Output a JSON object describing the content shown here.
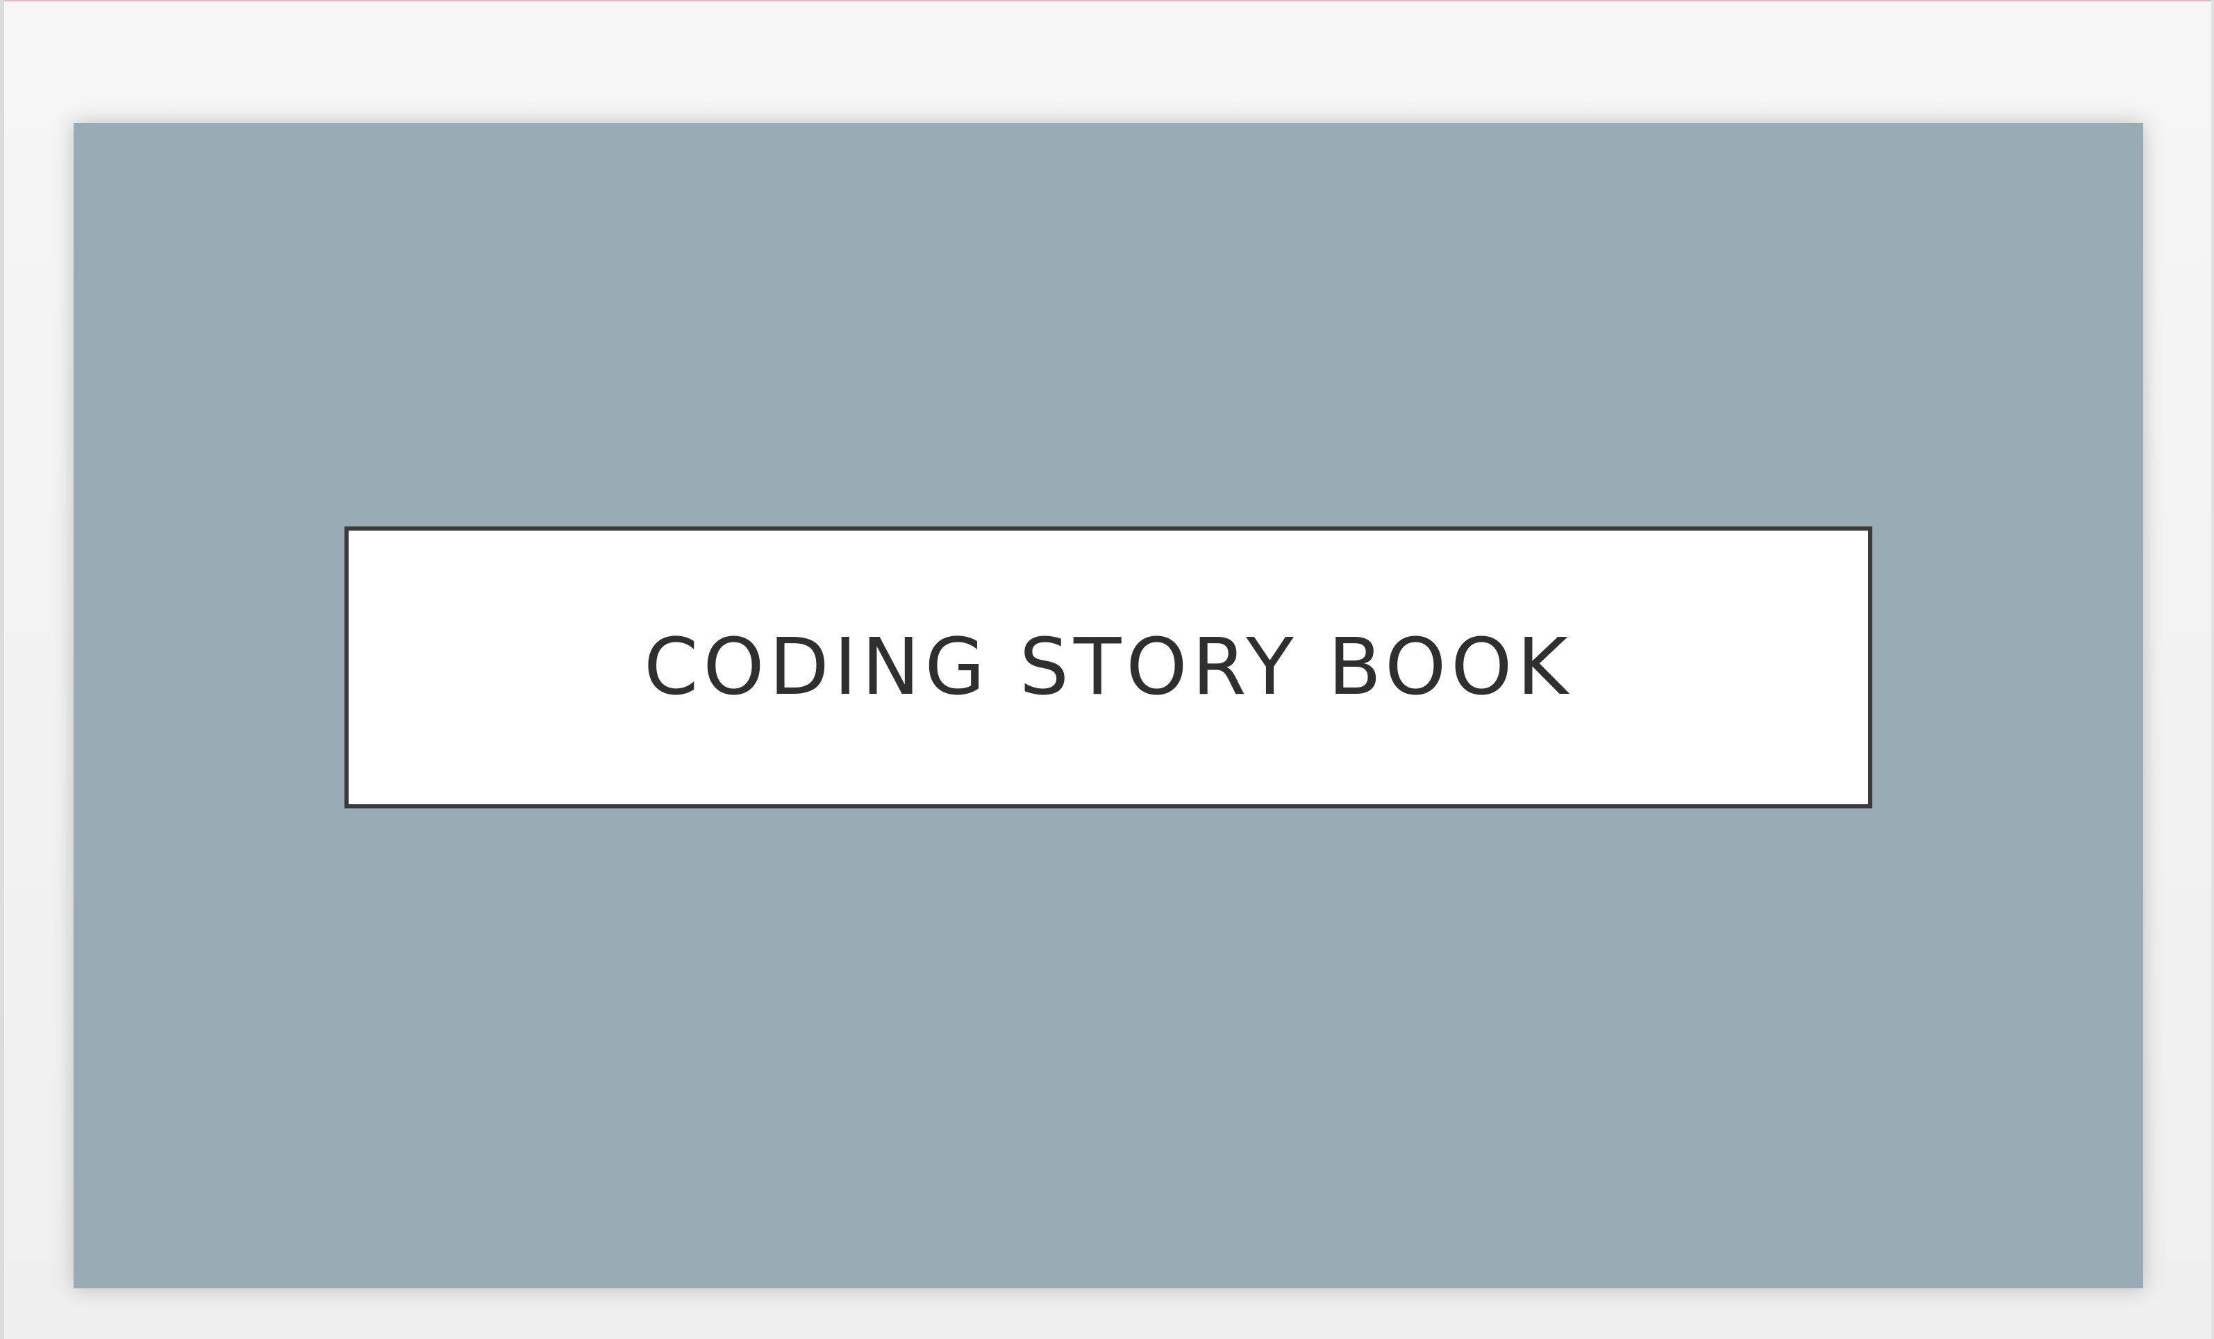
{
  "slide": {
    "title": "CODING STORY BOOK",
    "background_color": "#9AACB3",
    "title_box_color": "#FFFFFF",
    "title_border_color": "#3B3B3B",
    "title_text_color": "#2F2F2F"
  },
  "workspace": {
    "background_color": "#F4F4F4"
  }
}
